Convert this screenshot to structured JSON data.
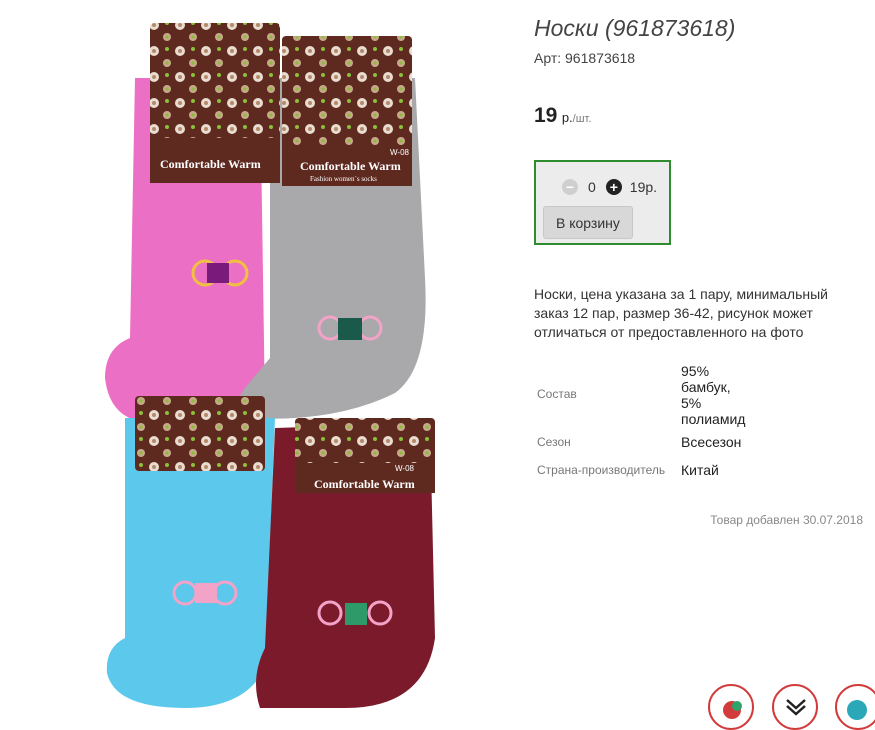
{
  "product": {
    "title": "Носки (961873618)",
    "sku": "Арт: 961873618"
  },
  "price": {
    "value": "19",
    "currency": "р.",
    "per": "/шт."
  },
  "cart": {
    "minus": "−",
    "quantity": "0",
    "plus": "+",
    "total": "19р.",
    "button_label": "В корзину"
  },
  "description": "Носки, цена указана за 1 пару, минимальный заказ 12 пар, размер 36-42, рисунок может отличаться от предоставленного на фото",
  "specs": [
    {
      "label": "Состав",
      "value_lines": [
        "95%",
        "бамбук,",
        "5%",
        "полиамид"
      ]
    },
    {
      "label": "Сезон",
      "value": "Всесезон"
    },
    {
      "label": "Страна-производитель",
      "value": "Китай"
    }
  ],
  "added_date": "Товар добавлен 30.07.2018",
  "image": {
    "label_text": "Comfortable Warm",
    "label_subtext": "Fashion women`s socks",
    "model": "W-08",
    "colors": {
      "pink": "#ec6fc6",
      "gray": "#a9a9ab",
      "blue": "#5cc8ec",
      "burgundy": "#7b1a2a",
      "tag": "#5e2a20",
      "tag_pattern": "#b48a6a"
    }
  },
  "accent": {
    "border_green": "#2e8b2e",
    "fab_red": "#d23b3b"
  },
  "fabs": [
    {
      "icon": "red-circle-icon"
    },
    {
      "icon": "chevrons-down-icon"
    },
    {
      "icon": "teal-circle-icon"
    }
  ]
}
